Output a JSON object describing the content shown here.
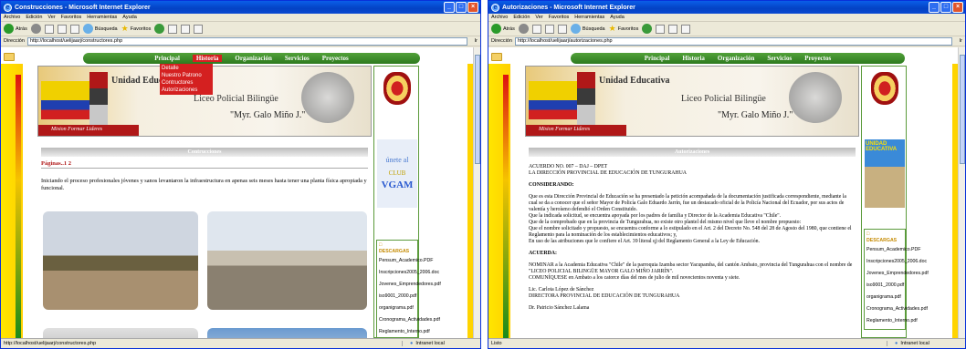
{
  "windows": [
    {
      "title": "Construcciones - Microsoft Internet Explorer",
      "address": "http://localhost/uelijaarj/constructores.php",
      "status": "http://localhost/uelijaarj/constructores.php",
      "page_header": "Contrucciones"
    },
    {
      "title": "Autorizaciones - Microsoft Internet Explorer",
      "address": "http://localhost/uelijaarj/autorizaciones.php",
      "status": "Listo",
      "page_header": "Autorizaciones"
    }
  ],
  "menu": [
    "Archivo",
    "Edición",
    "Ver",
    "Favoritos",
    "Herramientas",
    "Ayuda"
  ],
  "toolbar": {
    "back": "Atrás",
    "search": "Búsqueda",
    "favorites": "Favoritos"
  },
  "address_label": "Dirección",
  "go": "Ir",
  "zone": "Intranet local",
  "nav": [
    "Principal",
    "Historia",
    "Organización",
    "Servicios",
    "Proyectos"
  ],
  "historia_menu": [
    "Detalle",
    "Nuestro Patrono",
    "Contructores",
    "Autorizaciones"
  ],
  "banner": {
    "l1": "Unidad Educativa",
    "l2": "Liceo Policial Bilingüe",
    "l3": "\"Myr. Galo Miño J.\"",
    "motto": "Mision Formar Lideres"
  },
  "construcciones": {
    "pages": "Páginas..1 2",
    "text": "Iniciando el proceso profesionales jóvenes y sanos levantaron la infraestructura en apenas seis meses hasta tener una planta física apropiada y funcional."
  },
  "autorizaciones": {
    "acuerdo": "ACUERDO NO. 007 – DAJ – DPET",
    "direccion": "LA DIRECCIÓN PROVINCIAL DE EDUCACIÓN DE TUNGURAHUA",
    "considerando": "CONSIDERANDO:",
    "p1": "Que es esta Dirección Provincial de Educación se ha presentado la petición acompañada de la documentación justificada correspondiente, mediante la cual se da a conocer que el señor Mayor de Policía Galo Eduardo Jarrín, fue un destacado oficial de la Policía Nacional del Ecuador, por sus actos de valentía y heroísmo defendió el Orden Constituido.",
    "p2": "Que la indicada solicitud, se encuentra apoyada por los padres de familia y Director de la Academia Educativa \"Chile\".",
    "p3": "Que de la comprobado que en la provincia de Tungurahua, no existe otro plantel del mismo nivel que lleve el nombre propuesto:",
    "p4": "Que el nombre solicitado y propuesto, se encuentra conforme a lo estipulado en el Art. 2 del Decreto No. 548 del 28 de Agosto del 1980, que contiene el Reglamento para la nominación de los establecimientos educativos; y,",
    "p5": "En uso de las atribuciones que le confiere el Art. 39 literal q) del Reglamento General a la Ley de Educación.",
    "acuerda": "ACUERDA:",
    "p6": "NOMINAR a la Academia Educativa \"Chile\" de la parroquia Izamba sector Yacupamba, del cantón Ambato, provincia del Tungurahua con el nombre de \"LICEO POLICIAL BILINGÜE MAYOR GALO MIÑO JARRÍN\".",
    "p7": "COMUNÍQUESE en Ambato a los catorce días del mes de julio de mil novecientos noventa y siete.",
    "firma1": "Lic. Carlota López de Sánchez",
    "firma2": "DIRECTORA PROVINCIAL DE EDUCACIÓN DE TUNGURAHUA",
    "firma3": "Dr. Patricio Sánchez Lalama"
  },
  "side_ad": {
    "l1": "únete al",
    "l2": "CLUB",
    "l3": "VGAM"
  },
  "side_img_text": "UNIDAD EDUCATIVA",
  "downloads": {
    "header": "DESCARGAS",
    "items": [
      "Pensum_Academico.PDF",
      "Inscripciones2005_2006.doc",
      "Jovenes_Emprendedores.pdf",
      "iso9001_2000.pdf",
      "organigrama.pdf",
      "Cronograma_Actividades.pdf",
      "Reglamento_Interno.pdf"
    ]
  }
}
